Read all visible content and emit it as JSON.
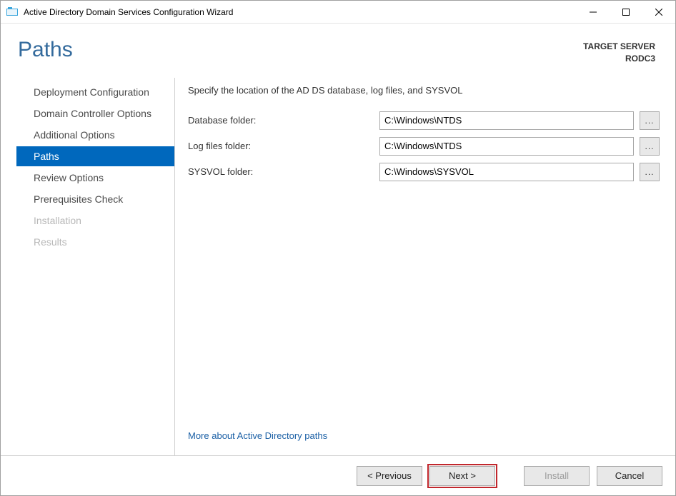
{
  "window": {
    "title": "Active Directory Domain Services Configuration Wizard"
  },
  "header": {
    "page_title": "Paths",
    "target_label": "TARGET SERVER",
    "target_value": "RODC3"
  },
  "sidebar": {
    "steps": [
      {
        "label": "Deployment Configuration",
        "state": "normal"
      },
      {
        "label": "Domain Controller Options",
        "state": "normal"
      },
      {
        "label": "Additional Options",
        "state": "normal"
      },
      {
        "label": "Paths",
        "state": "selected"
      },
      {
        "label": "Review Options",
        "state": "normal"
      },
      {
        "label": "Prerequisites Check",
        "state": "normal"
      },
      {
        "label": "Installation",
        "state": "disabled"
      },
      {
        "label": "Results",
        "state": "disabled"
      }
    ]
  },
  "content": {
    "instruction": "Specify the location of the AD DS database, log files, and SYSVOL",
    "fields": {
      "database": {
        "label": "Database folder:",
        "value": "C:\\Windows\\NTDS",
        "browse": "..."
      },
      "logfiles": {
        "label": "Log files folder:",
        "value": "C:\\Windows\\NTDS",
        "browse": "..."
      },
      "sysvol": {
        "label": "SYSVOL folder:",
        "value": "C:\\Windows\\SYSVOL",
        "browse": "..."
      }
    },
    "more_link": "More about Active Directory paths"
  },
  "footer": {
    "previous": "< Previous",
    "next": "Next >",
    "install": "Install",
    "cancel": "Cancel"
  }
}
